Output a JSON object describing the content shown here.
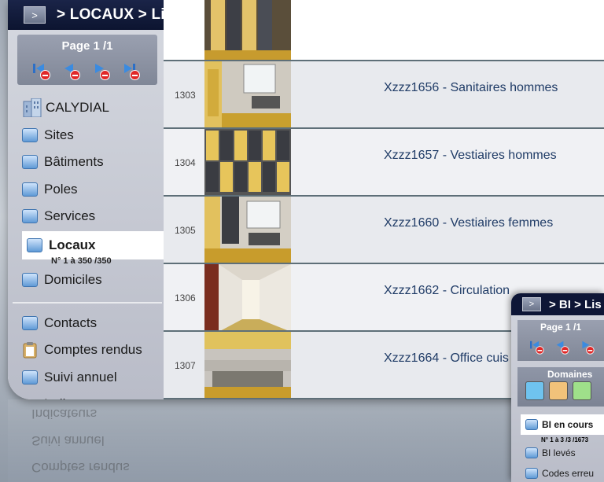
{
  "title": {
    "toggle": ">",
    "path": "> LOCAUX > Liste"
  },
  "pager": {
    "page_label": "Page 1 /1"
  },
  "sidebar": {
    "items": [
      {
        "label": "CALYDIAL"
      },
      {
        "label": "Sites"
      },
      {
        "label": "Bâtiments"
      },
      {
        "label": "Poles"
      },
      {
        "label": "Services"
      },
      {
        "label": "Locaux"
      },
      {
        "label": "Domiciles"
      },
      {
        "label": "Contacts"
      },
      {
        "label": "Comptes rendus"
      },
      {
        "label": "Suivi annuel"
      },
      {
        "label": "Indicateurs"
      }
    ],
    "active_sub": "N° 1 à 350 /350"
  },
  "rows": [
    {
      "num": "1303",
      "name": "Xzzz1656 - Sanitaires hommes"
    },
    {
      "num": "1304",
      "name": "Xzzz1657 - Vestiaires hommes"
    },
    {
      "num": "1305",
      "name": "Xzzz1660 - Vestiaires femmes"
    },
    {
      "num": "1306",
      "name": "Xzzz1662 - Circulation"
    },
    {
      "num": "1307",
      "name": "Xzzz1664 - Office cuis"
    }
  ],
  "overlay": {
    "toggle": ">",
    "path": "> BI > Lis",
    "page_label": "Page 1 /1",
    "domains_label": "Domaines",
    "items": [
      {
        "label": "BI en cours"
      },
      {
        "label": "BI levés"
      },
      {
        "label": "Codes erreu"
      }
    ],
    "active_sub": "N° 1 à 3 /3 /1673"
  },
  "colors": {
    "title_bg": "#0c1430",
    "row_border": "#5e6f78",
    "link": "#1f3b66"
  }
}
